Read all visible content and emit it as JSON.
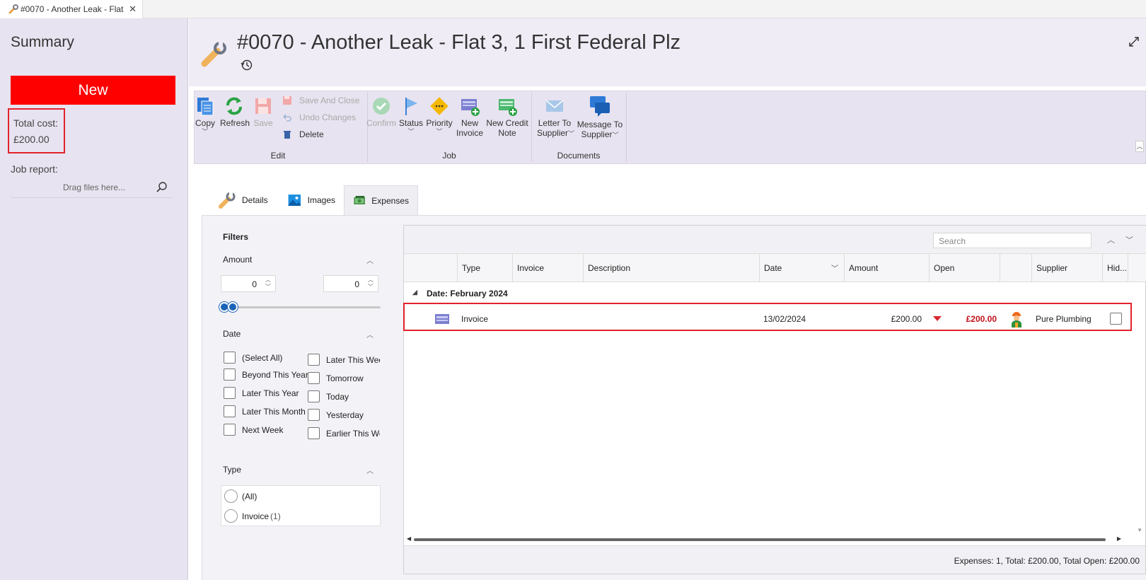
{
  "window": {
    "tab_title": "#0070 - Another Leak - Flat",
    "close_glyph": "✕"
  },
  "summary": {
    "title": "Summary",
    "status_button": "New",
    "status_color": "#ff0000",
    "total_cost_label": "Total cost:",
    "total_cost_value": "£200.00",
    "job_report_label": "Job report:",
    "drag_placeholder": "Drag files here..."
  },
  "header": {
    "title": "#0070 - Another Leak - Flat 3, 1 First Federal Plz"
  },
  "ribbon": {
    "edit": {
      "copy": "Copy",
      "refresh": "Refresh",
      "save": "Save",
      "save_and_close": "Save And Close",
      "undo_changes": "Undo Changes",
      "delete": "Delete",
      "group_label": "Edit"
    },
    "job": {
      "confirm": "Confirm",
      "status": "Status",
      "priority": "Priority",
      "new_invoice_line1": "New",
      "new_invoice_line2": "Invoice",
      "new_credit_note_line1": "New Credit",
      "new_credit_note_line2": "Note",
      "group_label": "Job"
    },
    "documents": {
      "letter_line1": "Letter To",
      "letter_line2": "Supplier",
      "message_line1": "Message To",
      "message_line2": "Supplier",
      "group_label": "Documents"
    }
  },
  "tabs": [
    {
      "label": "Details"
    },
    {
      "label": "Images"
    },
    {
      "label": "Expenses"
    }
  ],
  "filters": {
    "title": "Filters",
    "amount": {
      "label": "Amount",
      "min": "0",
      "max": "0"
    },
    "date": {
      "label": "Date",
      "left_options": [
        "(Select All)",
        "Beyond This Year",
        "Later This Year",
        "Later This Month",
        "Next Week"
      ],
      "right_options": [
        "Later This Wee",
        "Tomorrow",
        "Today",
        "Yesterday",
        "Earlier This We"
      ]
    },
    "type": {
      "label": "Type",
      "options": [
        {
          "label": "(All)",
          "count": ""
        },
        {
          "label": "Invoice",
          "count": "(1)"
        }
      ]
    }
  },
  "grid": {
    "search_placeholder": "Search",
    "columns": [
      "Type",
      "Invoice",
      "Description",
      "Date",
      "Amount",
      "Open",
      "Supplier",
      "Hid..."
    ],
    "group_label": "Date: February 2024",
    "rows": [
      {
        "type": "Invoice",
        "invoice": "",
        "description": "",
        "date": "13/02/2024",
        "amount": "£200.00",
        "open": "£200.00",
        "supplier": "Pure Plumbing",
        "hidden": false
      }
    ],
    "footer": "Expenses: 1, Total: £200.00, Total Open: £200.00"
  },
  "icons": {
    "tab": "wrench-icon",
    "search": "search-icon",
    "history": "history-icon",
    "expand": "expand-icon"
  }
}
